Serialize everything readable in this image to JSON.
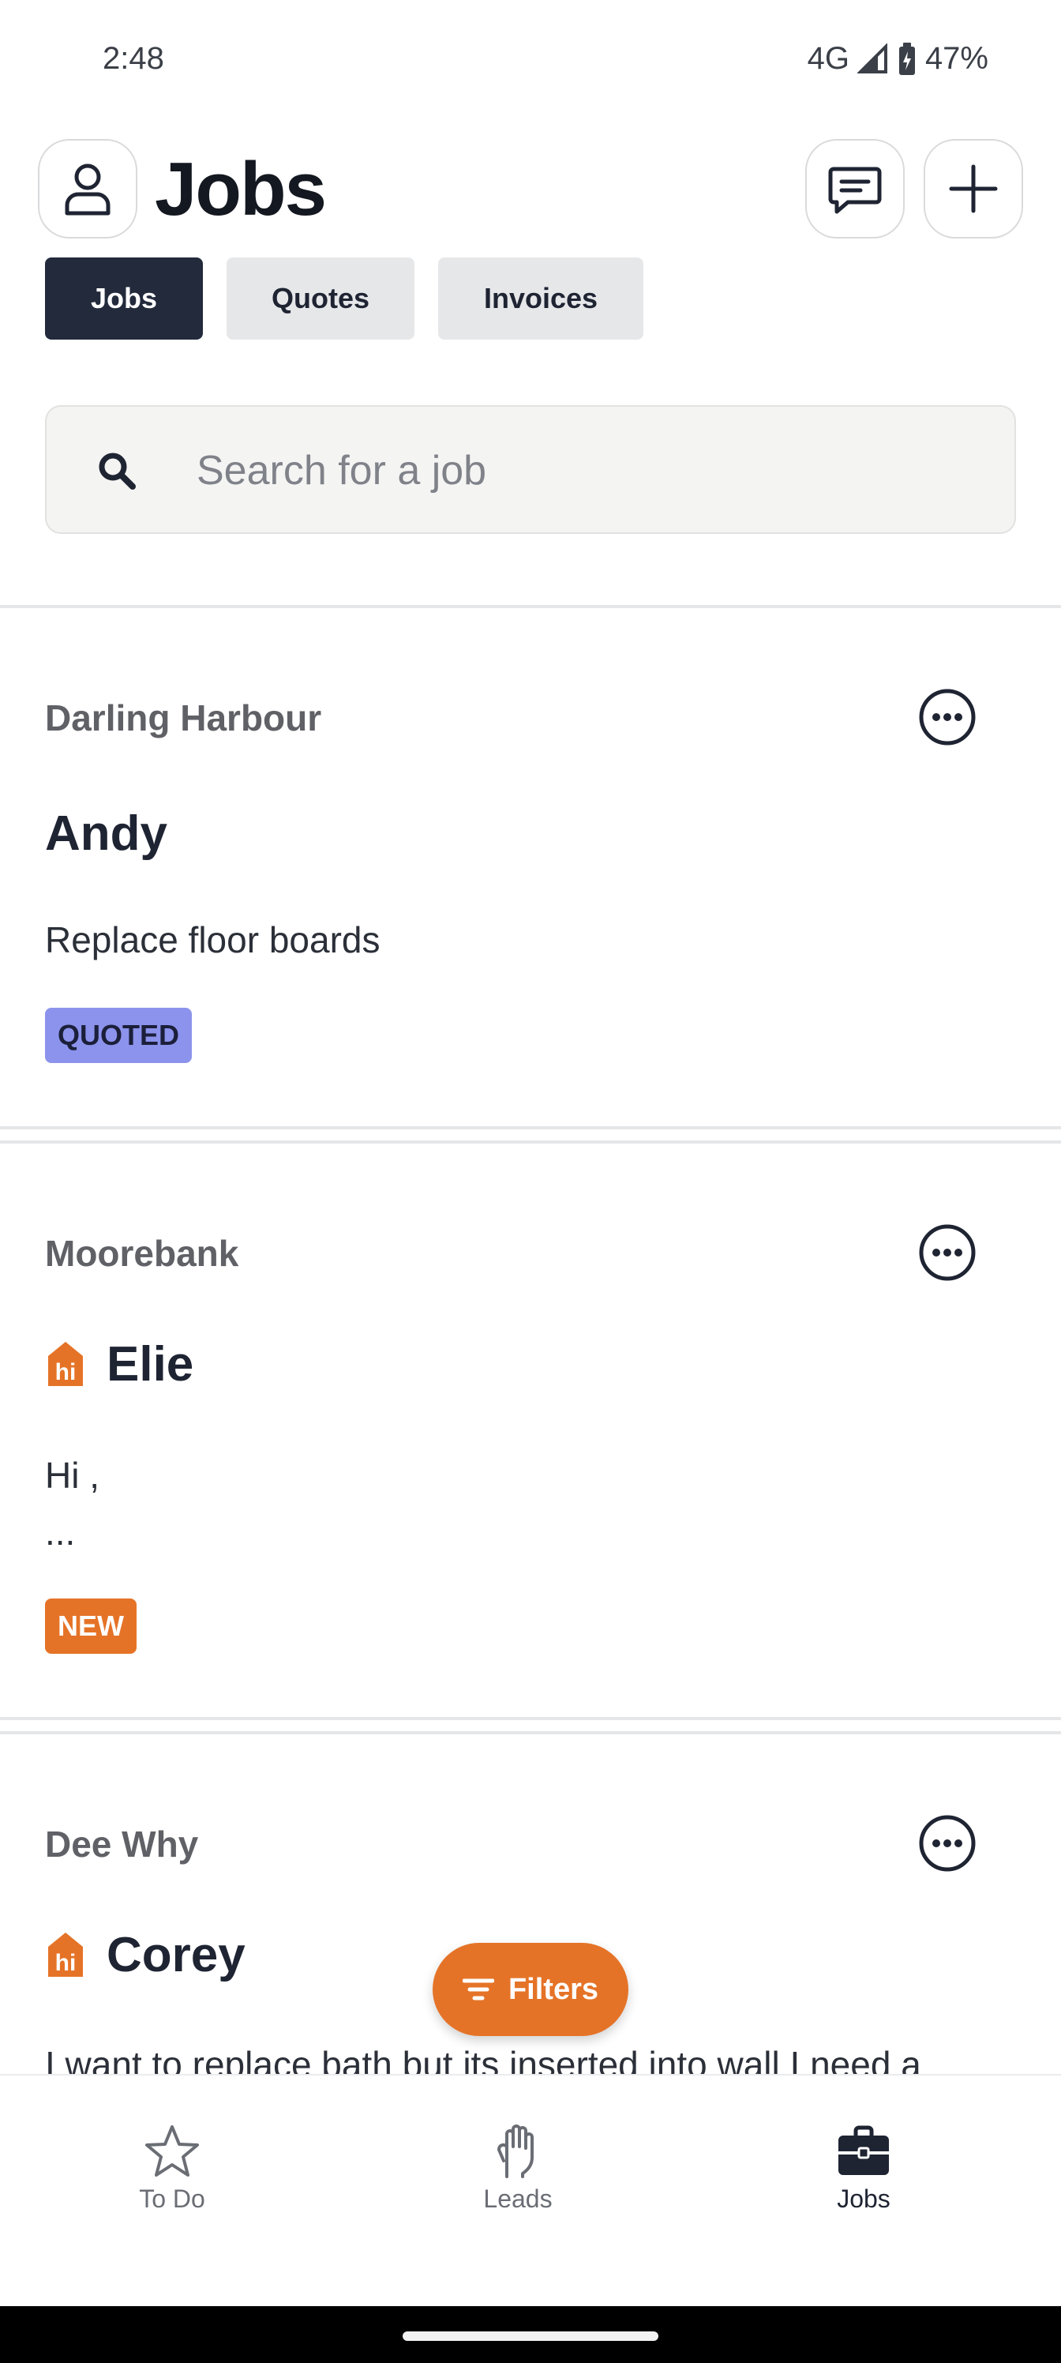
{
  "status": {
    "time": "2:48",
    "network": "4G",
    "battery": "47%"
  },
  "header": {
    "title": "Jobs"
  },
  "tabs": [
    {
      "label": "Jobs",
      "active": true
    },
    {
      "label": "Quotes",
      "active": false
    },
    {
      "label": "Invoices",
      "active": false
    }
  ],
  "search": {
    "placeholder": "Search for a job",
    "value": ""
  },
  "jobs": [
    {
      "location": "Darling Harbour",
      "name": "Andy",
      "description": "Replace floor boards",
      "badge": "QUOTED",
      "hipages": false
    },
    {
      "location": "Moorebank",
      "name": "Elie",
      "description": "Hi ,\n...",
      "badge": "NEW",
      "hipages": true
    },
    {
      "location": "Dee Why",
      "name": "Corey",
      "description": "I want to replace bath but its inserted into wall I need a",
      "badge": "",
      "hipages": true
    }
  ],
  "hipages_logo_text": "hi",
  "filters": {
    "label": "Filters"
  },
  "bottom_nav": [
    {
      "label": "To Do",
      "icon": "star-icon",
      "active": false
    },
    {
      "label": "Leads",
      "icon": "hand-icon",
      "active": false
    },
    {
      "label": "Jobs",
      "icon": "briefcase-icon",
      "active": true
    }
  ],
  "colors": {
    "accent": "#e57327",
    "primary_dark": "#222a3c",
    "quoted_badge": "#8c93ec",
    "new_badge": "#e57327"
  }
}
